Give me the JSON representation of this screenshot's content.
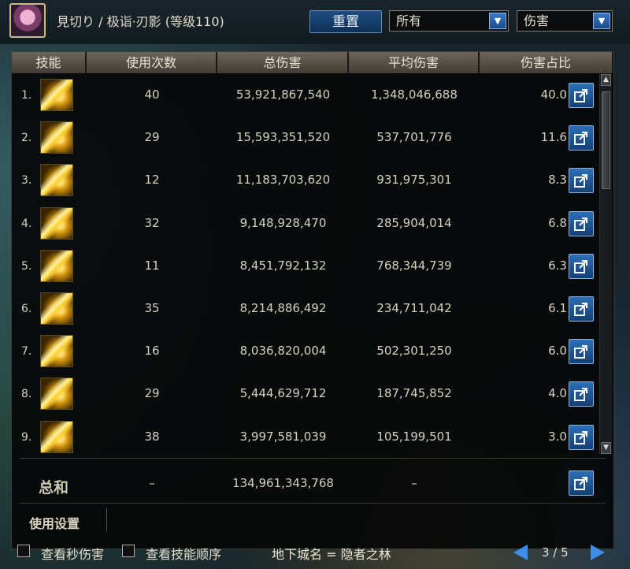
{
  "player": {
    "title": "見切り / 极诣·刃影 (等级110)"
  },
  "controls": {
    "reset_label": "重置",
    "filter_value": "所有",
    "type_value": "伤害"
  },
  "table": {
    "headers": [
      "技能",
      "使用次数",
      "总伤害",
      "平均伤害",
      "伤害占比"
    ],
    "rows": [
      {
        "rank": "1.",
        "uses": "40",
        "total": "53,921,867,540",
        "avg": "1,348,046,688",
        "pct": "40.0 %"
      },
      {
        "rank": "2.",
        "uses": "29",
        "total": "15,593,351,520",
        "avg": "537,701,776",
        "pct": "11.6 %"
      },
      {
        "rank": "3.",
        "uses": "12",
        "total": "11,183,703,620",
        "avg": "931,975,301",
        "pct": "8.3 %"
      },
      {
        "rank": "4.",
        "uses": "32",
        "total": "9,148,928,470",
        "avg": "285,904,014",
        "pct": "6.8 %"
      },
      {
        "rank": "5.",
        "uses": "11",
        "total": "8,451,792,132",
        "avg": "768,344,739",
        "pct": "6.3 %"
      },
      {
        "rank": "6.",
        "uses": "35",
        "total": "8,214,886,492",
        "avg": "234,711,042",
        "pct": "6.1 %"
      },
      {
        "rank": "7.",
        "uses": "16",
        "total": "8,036,820,004",
        "avg": "502,301,250",
        "pct": "6.0 %"
      },
      {
        "rank": "8.",
        "uses": "29",
        "total": "5,444,629,712",
        "avg": "187,745,852",
        "pct": "4.0 %"
      },
      {
        "rank": "9.",
        "uses": "38",
        "total": "3,997,581,039",
        "avg": "105,199,501",
        "pct": "3.0 %"
      }
    ],
    "summary": {
      "label": "总和",
      "uses": "–",
      "total": "134,961,343,768",
      "avg": "–"
    }
  },
  "settings": {
    "label": "使用设置"
  },
  "footer": {
    "checkbox_dps": "查看秒伤害",
    "checkbox_order": "查看技能顺序",
    "dungeon": "地下城名 = 隐者之林",
    "page": "3 / 5"
  },
  "icons": {
    "share": "share-icon",
    "scroll_up": "scroll-up-icon",
    "scroll_down": "scroll-down-icon",
    "dropdown": "chevron-down-icon"
  },
  "colors": {
    "accent_blue": "#2d6fb8",
    "skill_gold": "#ffd23a"
  }
}
